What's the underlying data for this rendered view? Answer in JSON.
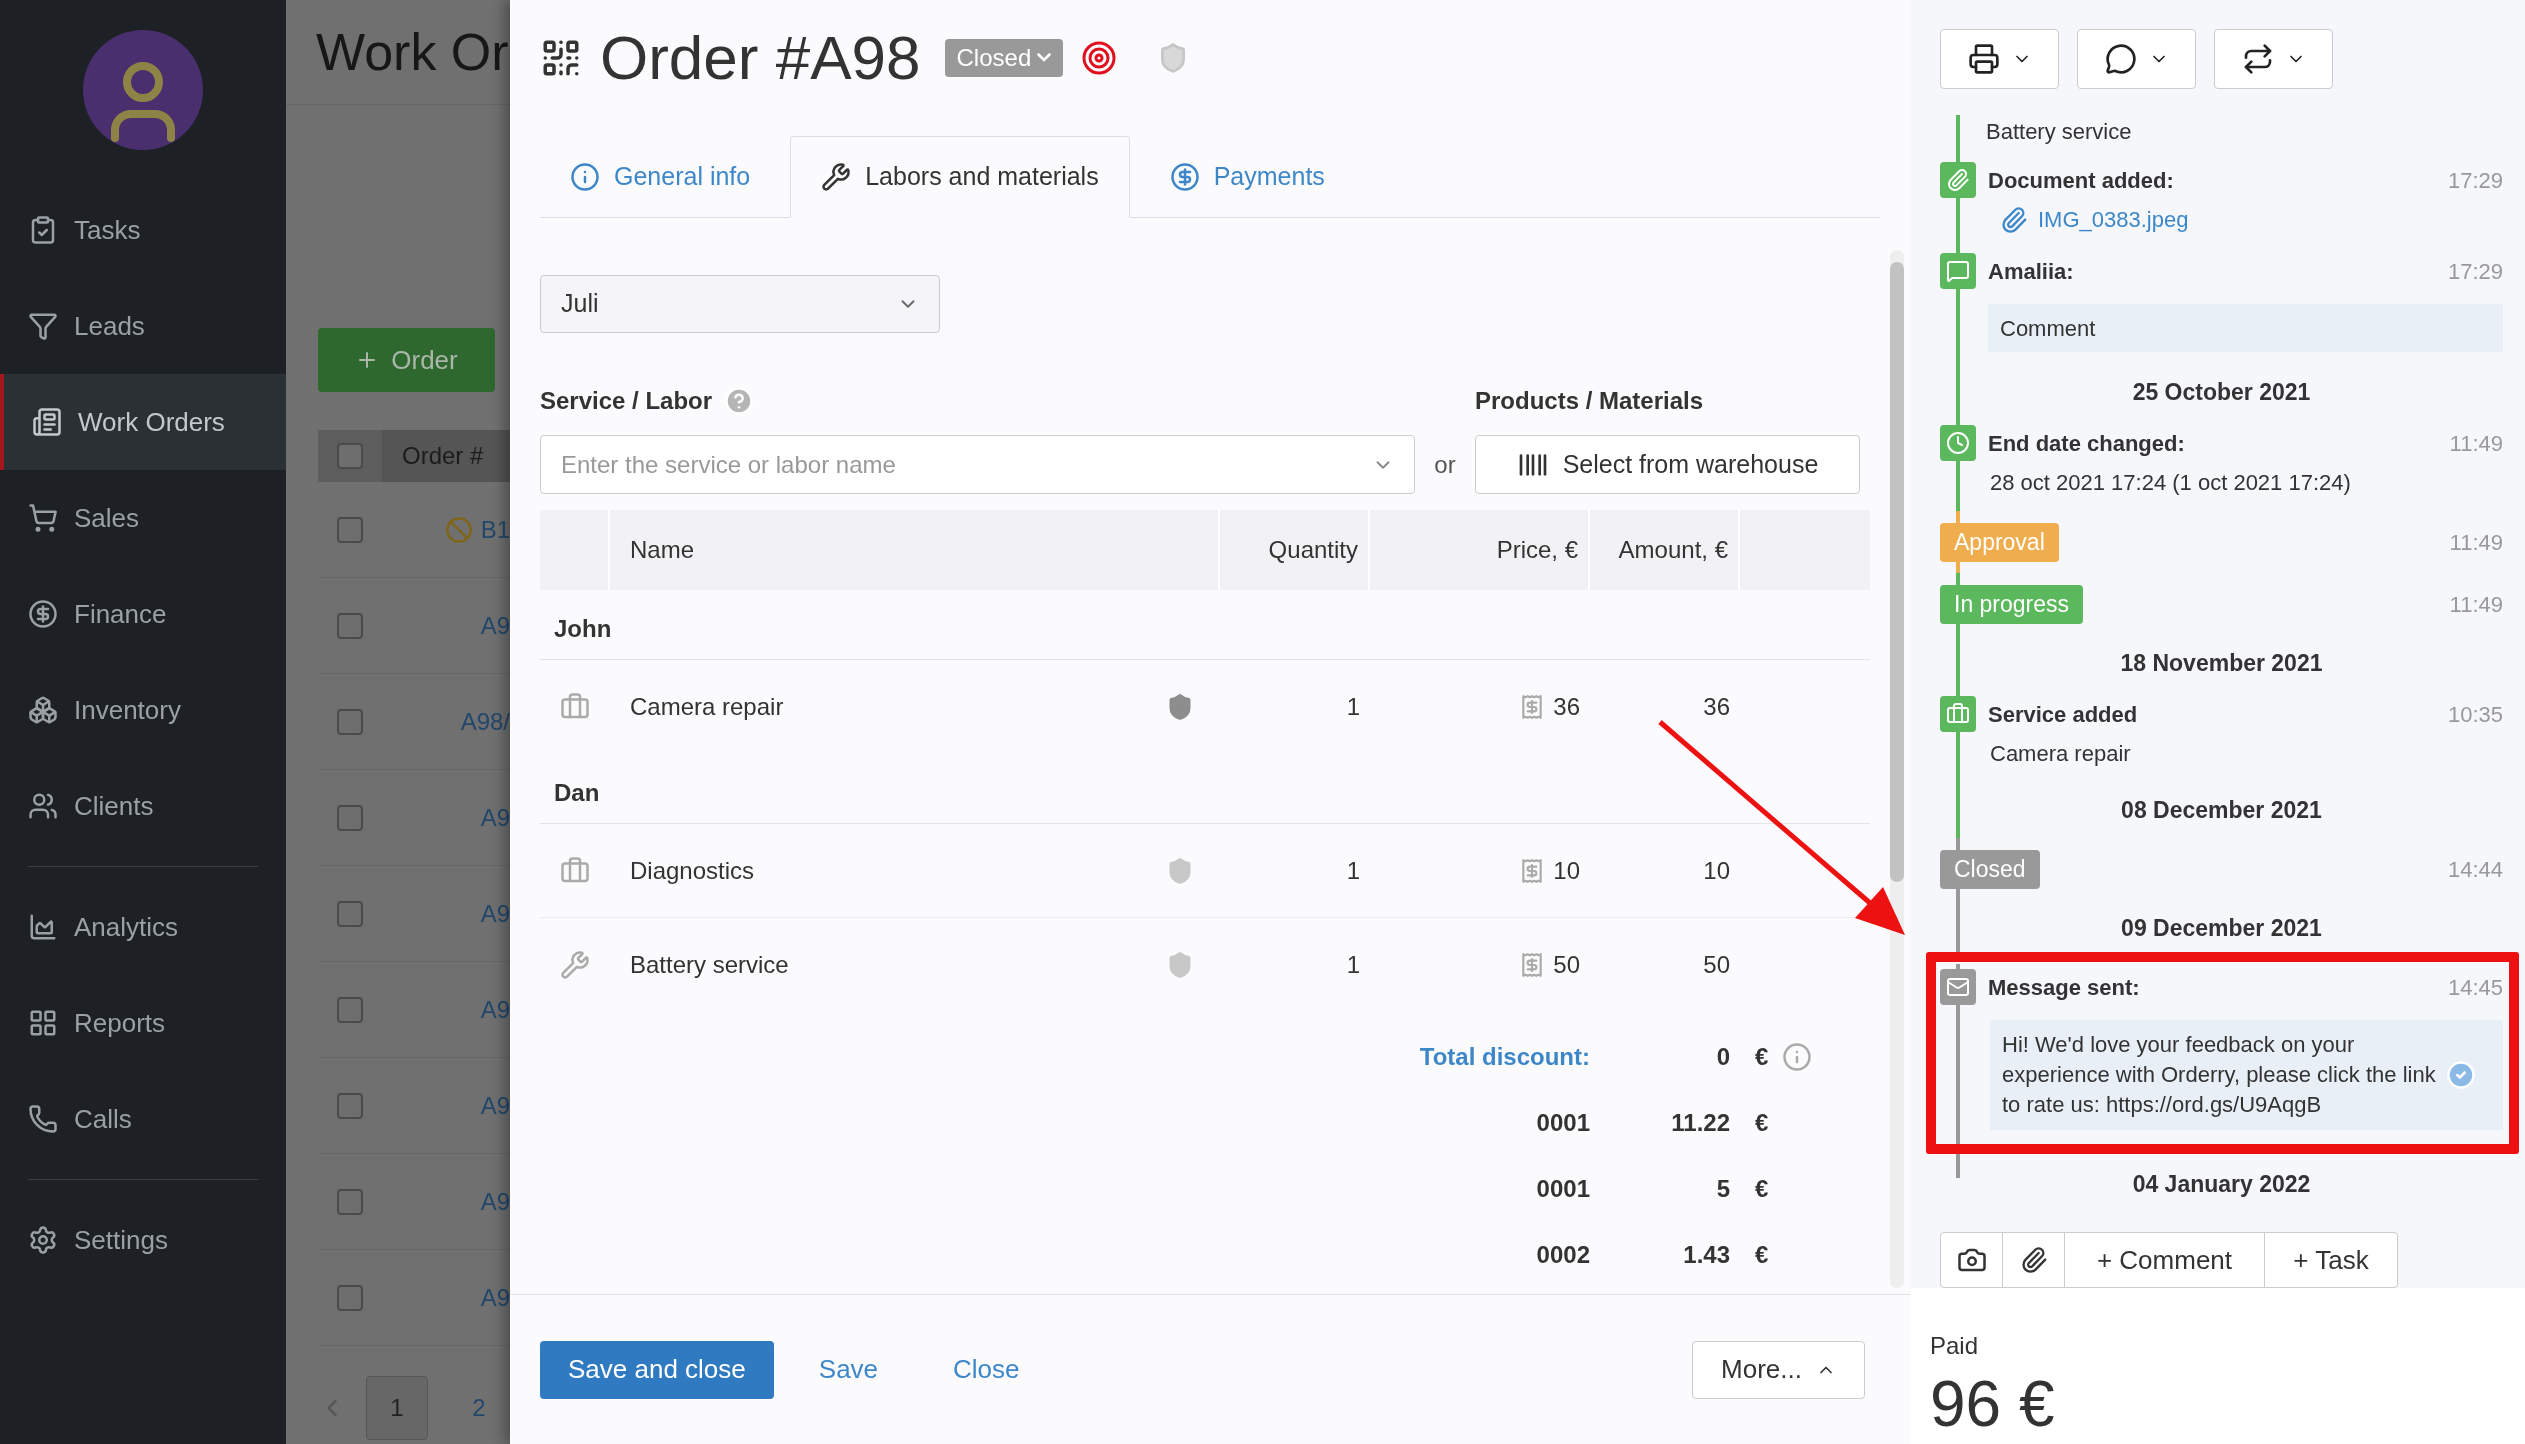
{
  "sidebar": {
    "groups": [
      [
        {
          "label": "Tasks",
          "selected": false
        },
        {
          "label": "Leads",
          "selected": false
        },
        {
          "label": "Work Orders",
          "selected": true
        },
        {
          "label": "Sales",
          "selected": false
        },
        {
          "label": "Finance",
          "selected": false
        },
        {
          "label": "Inventory",
          "selected": false
        },
        {
          "label": "Clients",
          "selected": false
        }
      ],
      [
        {
          "label": "Analytics",
          "selected": false
        },
        {
          "label": "Reports",
          "selected": false
        },
        {
          "label": "Calls",
          "selected": false
        }
      ],
      [
        {
          "label": "Settings",
          "selected": false
        }
      ]
    ]
  },
  "background_page": {
    "title": "Work Or",
    "add_button": "Order",
    "table": {
      "header": "Order #",
      "header_checked": false,
      "rows": [
        {
          "number": "B1",
          "kind": "blocked",
          "checked": false
        },
        {
          "number": "A9",
          "kind": "plain",
          "checked": false
        },
        {
          "number": "A98/",
          "kind": "plain",
          "checked": false
        },
        {
          "number": "A9",
          "kind": "plain",
          "checked": false
        },
        {
          "number": "A9",
          "kind": "plain",
          "checked": false
        },
        {
          "number": "A9",
          "kind": "plain",
          "checked": false
        },
        {
          "number": "A9",
          "kind": "plain",
          "checked": false
        },
        {
          "number": "A9",
          "kind": "plain",
          "checked": false
        },
        {
          "number": "A9",
          "kind": "plain",
          "checked": false
        }
      ]
    },
    "pages": [
      {
        "label": "1",
        "selected": true
      },
      {
        "label": "2",
        "selected": false
      }
    ]
  },
  "order": {
    "title": "Order #A98",
    "status": "Closed",
    "tabs": [
      {
        "label": "General info",
        "selected": false
      },
      {
        "label": "Labors and materials",
        "selected": true
      },
      {
        "label": "Payments",
        "selected": false
      }
    ],
    "specialist": "Juli",
    "service_label": "Service / Labor",
    "service_placeholder": "Enter the service or labor name",
    "or": "or",
    "products_label": "Products / Materials",
    "warehouse_button": "Select from warehouse",
    "columns": [
      "Name",
      "Quantity",
      "Price, €",
      "Amount, €"
    ],
    "groups": [
      {
        "name": "John",
        "rows": [
          {
            "kind": "service",
            "name": "Camera repair",
            "warranty": true,
            "quantity": "1",
            "price": "36",
            "amount": "36"
          }
        ]
      },
      {
        "name": "Dan",
        "rows": [
          {
            "kind": "service",
            "name": "Diagnostics",
            "warranty": false,
            "quantity": "1",
            "price": "10",
            "amount": "10"
          },
          {
            "kind": "labor",
            "name": "Battery service",
            "warranty": false,
            "quantity": "1",
            "price": "50",
            "amount": "50"
          }
        ]
      }
    ],
    "totals": [
      {
        "kind": "discount",
        "label": "Total discount:",
        "value": "0",
        "currency": "€"
      },
      {
        "kind": "tax",
        "label": "0001",
        "value": "11.22",
        "currency": "€"
      },
      {
        "kind": "tax",
        "label": "0001",
        "value": "5",
        "currency": "€"
      },
      {
        "kind": "tax",
        "label": "0002",
        "value": "1.43",
        "currency": "€"
      }
    ],
    "footer": {
      "save_close": "Save and close",
      "save": "Save",
      "close": "Close",
      "more": "More..."
    }
  },
  "timeline": {
    "events": [
      {
        "kind": "note",
        "text": "Battery service"
      },
      {
        "kind": "document",
        "title": "Document added:",
        "time": "17:29",
        "file": "IMG_0383.jpeg"
      },
      {
        "kind": "comment",
        "title": "Amaliia:",
        "time": "17:29",
        "text": "Comment"
      },
      {
        "kind": "date",
        "text": "25 October 2021"
      },
      {
        "kind": "change",
        "title": "End date changed:",
        "time": "11:49",
        "text": "28 oct 2021 17:24 (1 oct 2021 17:24)"
      },
      {
        "kind": "status",
        "title": "Approval",
        "time": "11:49",
        "color": "#f0ad4e"
      },
      {
        "kind": "status",
        "title": "In progress",
        "time": "11:49",
        "color": "#5cb85c"
      },
      {
        "kind": "date",
        "text": "18 November 2021"
      },
      {
        "kind": "service",
        "title": "Service added",
        "time": "10:35",
        "text": "Camera repair"
      },
      {
        "kind": "date",
        "text": "08 December 2021"
      },
      {
        "kind": "status",
        "title": "Closed",
        "time": "14:44",
        "color": "#999999"
      },
      {
        "kind": "date",
        "text": "09 December 2021"
      },
      {
        "kind": "message",
        "title": "Message sent:",
        "time": "14:45",
        "text": "Hi! We'd love your feedback on your experience with Orderry, please click the link to rate us: https://ord.gs/U9AqgB",
        "delivered": true
      },
      {
        "kind": "date",
        "text": "04 January 2022"
      }
    ],
    "add_comment": "+ Comment",
    "add_task": "+ Task"
  },
  "paid": {
    "label": "Paid",
    "amount": "96 €"
  }
}
